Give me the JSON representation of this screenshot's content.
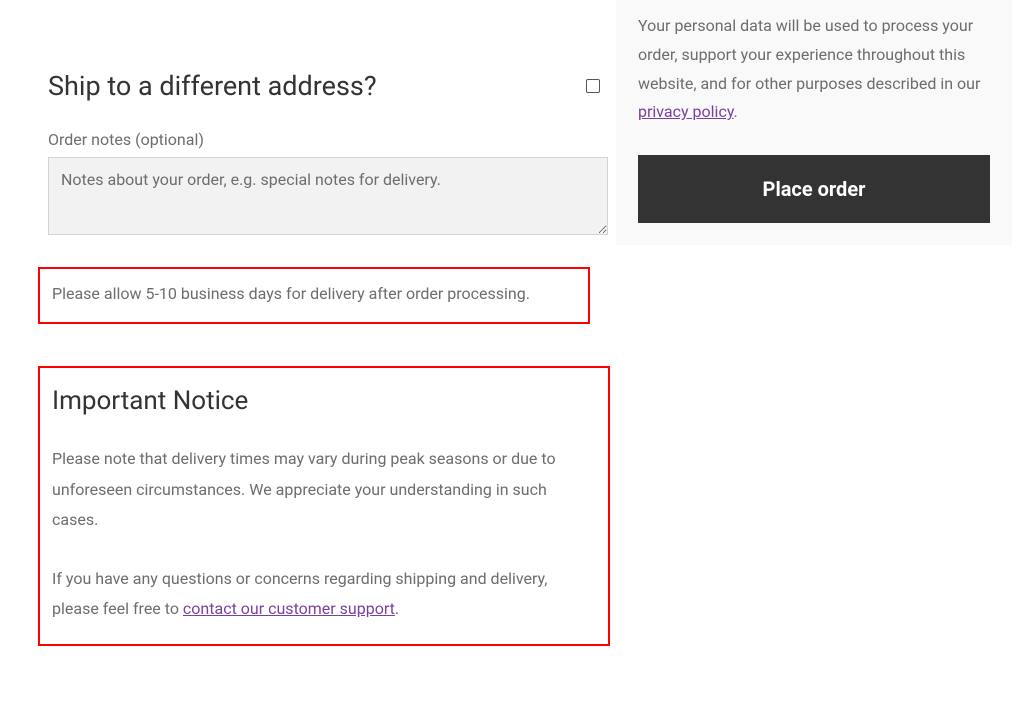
{
  "shipping": {
    "heading": "Ship to a different address?",
    "notesLabel": "Order notes (optional)",
    "notesPlaceholder": "Notes about your order, e.g. special notes for delivery."
  },
  "deliveryInfo": "Please allow 5-10 business days for delivery after order processing.",
  "notice": {
    "heading": "Important Notice",
    "paragraph1": "Please note that delivery times may vary during peak seasons or due to unforeseen circumstances. We appreciate your understanding in such cases.",
    "paragraph2a": "If you have any questions or concerns regarding shipping and delivery, please feel free to ",
    "linkText": "contact our customer support",
    "paragraph2b": "."
  },
  "sidebar": {
    "privacyTextA": "Your personal data will be used to process your order, support your experience throughout this website, and for other purposes described in our ",
    "privacyLink": "privacy policy",
    "privacyTextB": ".",
    "placeOrderLabel": "Place order"
  }
}
